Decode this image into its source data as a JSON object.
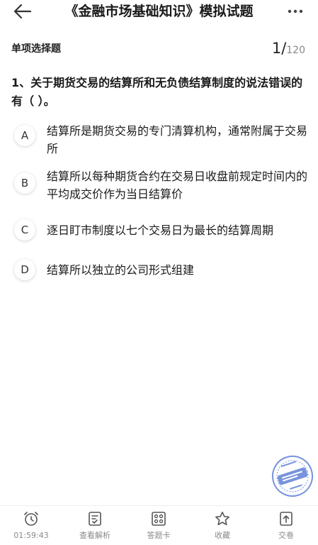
{
  "header": {
    "title": "《金融市场基础知识》模拟试题"
  },
  "question_info": {
    "type_label": "单项选择题",
    "current": "1",
    "separator": "/",
    "total": "120"
  },
  "question": {
    "text": "1、关于期货交易的结算所和无负债结算制度的说法错误的有（   ）。",
    "options": [
      {
        "letter": "A",
        "text": "结算所是期货交易的专门清算机构，通常附属于交易所"
      },
      {
        "letter": "B",
        "text": "结算所以每种期货合约在交易日收盘前规定时间内的平均成交价作为当日结算价"
      },
      {
        "letter": "C",
        "text": "逐日盯市制度以七个交易日为最长的结算周期"
      },
      {
        "letter": "D",
        "text": "结算所以独立的公司形式组建"
      }
    ]
  },
  "bottom_bar": {
    "timer": "01:59:43",
    "view_analysis": "查看解析",
    "answer_card": "答题卡",
    "favorite": "收藏",
    "submit": "交卷"
  },
  "colors": {
    "text": "#1a1a1a",
    "muted": "#8a8a8a",
    "stamp": "#4a6fd1"
  },
  "icons": [
    "back-arrow-icon",
    "more-dots-icon",
    "alarm-clock-icon",
    "analysis-doc-icon",
    "answer-card-grid-icon",
    "star-icon",
    "upload-submit-icon"
  ]
}
